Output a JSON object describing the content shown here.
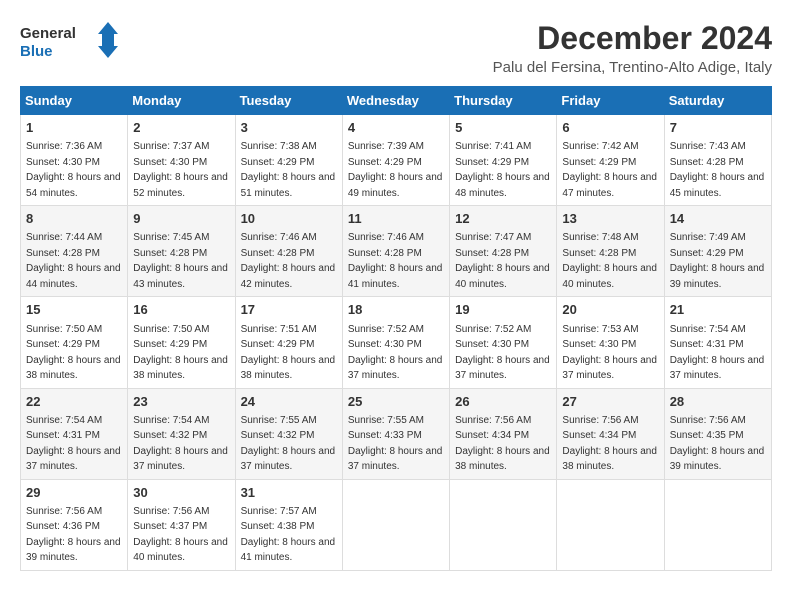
{
  "logo": {
    "text_general": "General",
    "text_blue": "Blue"
  },
  "header": {
    "month_title": "December 2024",
    "subtitle": "Palu del Fersina, Trentino-Alto Adige, Italy"
  },
  "weekdays": [
    "Sunday",
    "Monday",
    "Tuesday",
    "Wednesday",
    "Thursday",
    "Friday",
    "Saturday"
  ],
  "weeks": [
    [
      {
        "day": "1",
        "sunrise": "Sunrise: 7:36 AM",
        "sunset": "Sunset: 4:30 PM",
        "daylight": "Daylight: 8 hours and 54 minutes."
      },
      {
        "day": "2",
        "sunrise": "Sunrise: 7:37 AM",
        "sunset": "Sunset: 4:30 PM",
        "daylight": "Daylight: 8 hours and 52 minutes."
      },
      {
        "day": "3",
        "sunrise": "Sunrise: 7:38 AM",
        "sunset": "Sunset: 4:29 PM",
        "daylight": "Daylight: 8 hours and 51 minutes."
      },
      {
        "day": "4",
        "sunrise": "Sunrise: 7:39 AM",
        "sunset": "Sunset: 4:29 PM",
        "daylight": "Daylight: 8 hours and 49 minutes."
      },
      {
        "day": "5",
        "sunrise": "Sunrise: 7:41 AM",
        "sunset": "Sunset: 4:29 PM",
        "daylight": "Daylight: 8 hours and 48 minutes."
      },
      {
        "day": "6",
        "sunrise": "Sunrise: 7:42 AM",
        "sunset": "Sunset: 4:29 PM",
        "daylight": "Daylight: 8 hours and 47 minutes."
      },
      {
        "day": "7",
        "sunrise": "Sunrise: 7:43 AM",
        "sunset": "Sunset: 4:28 PM",
        "daylight": "Daylight: 8 hours and 45 minutes."
      }
    ],
    [
      {
        "day": "8",
        "sunrise": "Sunrise: 7:44 AM",
        "sunset": "Sunset: 4:28 PM",
        "daylight": "Daylight: 8 hours and 44 minutes."
      },
      {
        "day": "9",
        "sunrise": "Sunrise: 7:45 AM",
        "sunset": "Sunset: 4:28 PM",
        "daylight": "Daylight: 8 hours and 43 minutes."
      },
      {
        "day": "10",
        "sunrise": "Sunrise: 7:46 AM",
        "sunset": "Sunset: 4:28 PM",
        "daylight": "Daylight: 8 hours and 42 minutes."
      },
      {
        "day": "11",
        "sunrise": "Sunrise: 7:46 AM",
        "sunset": "Sunset: 4:28 PM",
        "daylight": "Daylight: 8 hours and 41 minutes."
      },
      {
        "day": "12",
        "sunrise": "Sunrise: 7:47 AM",
        "sunset": "Sunset: 4:28 PM",
        "daylight": "Daylight: 8 hours and 40 minutes."
      },
      {
        "day": "13",
        "sunrise": "Sunrise: 7:48 AM",
        "sunset": "Sunset: 4:28 PM",
        "daylight": "Daylight: 8 hours and 40 minutes."
      },
      {
        "day": "14",
        "sunrise": "Sunrise: 7:49 AM",
        "sunset": "Sunset: 4:29 PM",
        "daylight": "Daylight: 8 hours and 39 minutes."
      }
    ],
    [
      {
        "day": "15",
        "sunrise": "Sunrise: 7:50 AM",
        "sunset": "Sunset: 4:29 PM",
        "daylight": "Daylight: 8 hours and 38 minutes."
      },
      {
        "day": "16",
        "sunrise": "Sunrise: 7:50 AM",
        "sunset": "Sunset: 4:29 PM",
        "daylight": "Daylight: 8 hours and 38 minutes."
      },
      {
        "day": "17",
        "sunrise": "Sunrise: 7:51 AM",
        "sunset": "Sunset: 4:29 PM",
        "daylight": "Daylight: 8 hours and 38 minutes."
      },
      {
        "day": "18",
        "sunrise": "Sunrise: 7:52 AM",
        "sunset": "Sunset: 4:30 PM",
        "daylight": "Daylight: 8 hours and 37 minutes."
      },
      {
        "day": "19",
        "sunrise": "Sunrise: 7:52 AM",
        "sunset": "Sunset: 4:30 PM",
        "daylight": "Daylight: 8 hours and 37 minutes."
      },
      {
        "day": "20",
        "sunrise": "Sunrise: 7:53 AM",
        "sunset": "Sunset: 4:30 PM",
        "daylight": "Daylight: 8 hours and 37 minutes."
      },
      {
        "day": "21",
        "sunrise": "Sunrise: 7:54 AM",
        "sunset": "Sunset: 4:31 PM",
        "daylight": "Daylight: 8 hours and 37 minutes."
      }
    ],
    [
      {
        "day": "22",
        "sunrise": "Sunrise: 7:54 AM",
        "sunset": "Sunset: 4:31 PM",
        "daylight": "Daylight: 8 hours and 37 minutes."
      },
      {
        "day": "23",
        "sunrise": "Sunrise: 7:54 AM",
        "sunset": "Sunset: 4:32 PM",
        "daylight": "Daylight: 8 hours and 37 minutes."
      },
      {
        "day": "24",
        "sunrise": "Sunrise: 7:55 AM",
        "sunset": "Sunset: 4:32 PM",
        "daylight": "Daylight: 8 hours and 37 minutes."
      },
      {
        "day": "25",
        "sunrise": "Sunrise: 7:55 AM",
        "sunset": "Sunset: 4:33 PM",
        "daylight": "Daylight: 8 hours and 37 minutes."
      },
      {
        "day": "26",
        "sunrise": "Sunrise: 7:56 AM",
        "sunset": "Sunset: 4:34 PM",
        "daylight": "Daylight: 8 hours and 38 minutes."
      },
      {
        "day": "27",
        "sunrise": "Sunrise: 7:56 AM",
        "sunset": "Sunset: 4:34 PM",
        "daylight": "Daylight: 8 hours and 38 minutes."
      },
      {
        "day": "28",
        "sunrise": "Sunrise: 7:56 AM",
        "sunset": "Sunset: 4:35 PM",
        "daylight": "Daylight: 8 hours and 39 minutes."
      }
    ],
    [
      {
        "day": "29",
        "sunrise": "Sunrise: 7:56 AM",
        "sunset": "Sunset: 4:36 PM",
        "daylight": "Daylight: 8 hours and 39 minutes."
      },
      {
        "day": "30",
        "sunrise": "Sunrise: 7:56 AM",
        "sunset": "Sunset: 4:37 PM",
        "daylight": "Daylight: 8 hours and 40 minutes."
      },
      {
        "day": "31",
        "sunrise": "Sunrise: 7:57 AM",
        "sunset": "Sunset: 4:38 PM",
        "daylight": "Daylight: 8 hours and 41 minutes."
      },
      null,
      null,
      null,
      null
    ]
  ]
}
